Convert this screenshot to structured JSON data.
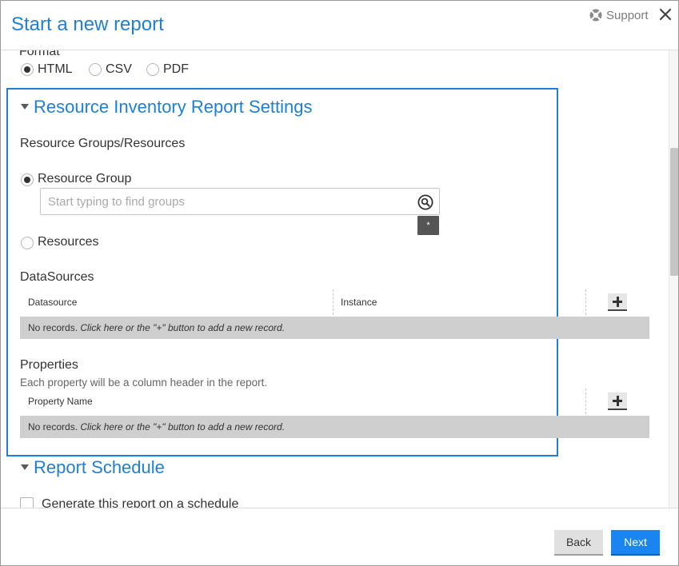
{
  "dialog": {
    "title": "Start a new report",
    "support_label": "Support"
  },
  "format": {
    "label": "Format",
    "options": [
      {
        "label": "HTML",
        "checked": true
      },
      {
        "label": "CSV",
        "checked": false
      },
      {
        "label": "PDF",
        "checked": false
      }
    ]
  },
  "settings": {
    "title": "Resource Inventory Report Settings",
    "resources_heading": "Resource Groups/Resources",
    "resource_group_label": "Resource Group",
    "search_placeholder": "Start typing to find groups",
    "asterisk": "*",
    "resources_label": "Resources",
    "datasources": {
      "heading": "DataSources",
      "columns": [
        "Datasource",
        "Instance"
      ],
      "empty_text_plain": "No records.",
      "empty_text_italic": "Click here or the \"+\" button to add a new record."
    },
    "properties": {
      "heading": "Properties",
      "description": "Each property will be a column header in the report.",
      "columns": [
        "Property Name"
      ],
      "empty_text_plain": "No records.",
      "empty_text_italic": "Click here or the \"+\" button to add a new record."
    }
  },
  "schedule": {
    "title": "Report Schedule",
    "checkbox_label": "Generate this report on a schedule"
  },
  "footer": {
    "back_label": "Back",
    "next_label": "Next"
  },
  "colors": {
    "accent": "#1e7fd6",
    "primary_button": "#1a84f0",
    "empty_row": "#cfcfcf"
  }
}
